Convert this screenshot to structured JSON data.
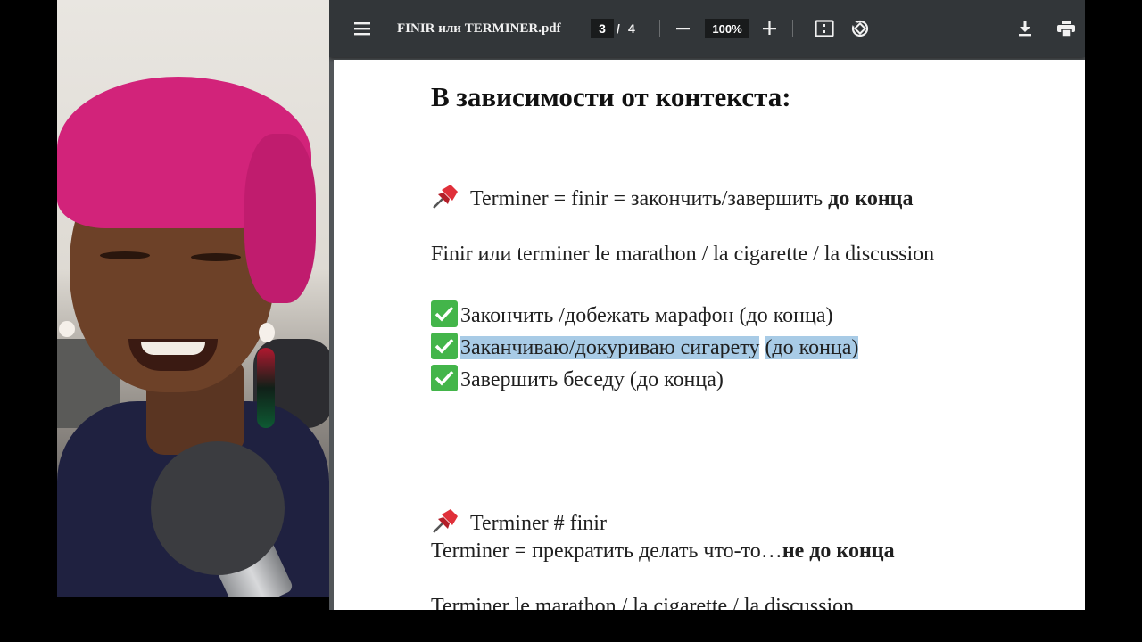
{
  "viewer": {
    "file_name": "FINIR или TERMINER.pdf",
    "page_current": "3",
    "page_separator": "/",
    "page_total": "4",
    "zoom": "100%",
    "colors": {
      "toolbar": "#323639",
      "background": "#525659",
      "highlight": "#a8cbe6",
      "check": "#43b54a"
    },
    "icons": [
      "menu-icon",
      "zoom-out-icon",
      "zoom-in-icon",
      "fit-page-icon",
      "rotate-icon",
      "download-icon",
      "print-icon"
    ]
  },
  "document": {
    "heading": "В зависимости от контекста:",
    "section1": {
      "title_text": "Terminer = finir = закончить/завершить ",
      "title_bold": "до конца",
      "example": "Finir или terminer le marathon / la cigarette / la discussion",
      "items": [
        {
          "text": "Закончить /добежать марафон (до конца)"
        },
        {
          "text_a": "Заканчиваю/докуриваю сигарету",
          "text_b": "(до конца)"
        },
        {
          "text": "Завершить беседу (до конца)"
        }
      ]
    },
    "section2": {
      "title_text": "Terminer # finir",
      "def_text": "Terminer = прекратить делать что-то…",
      "def_bold": "не до конца",
      "example_partial": "Terminer le marathon / la cigarette / la discussion"
    }
  }
}
